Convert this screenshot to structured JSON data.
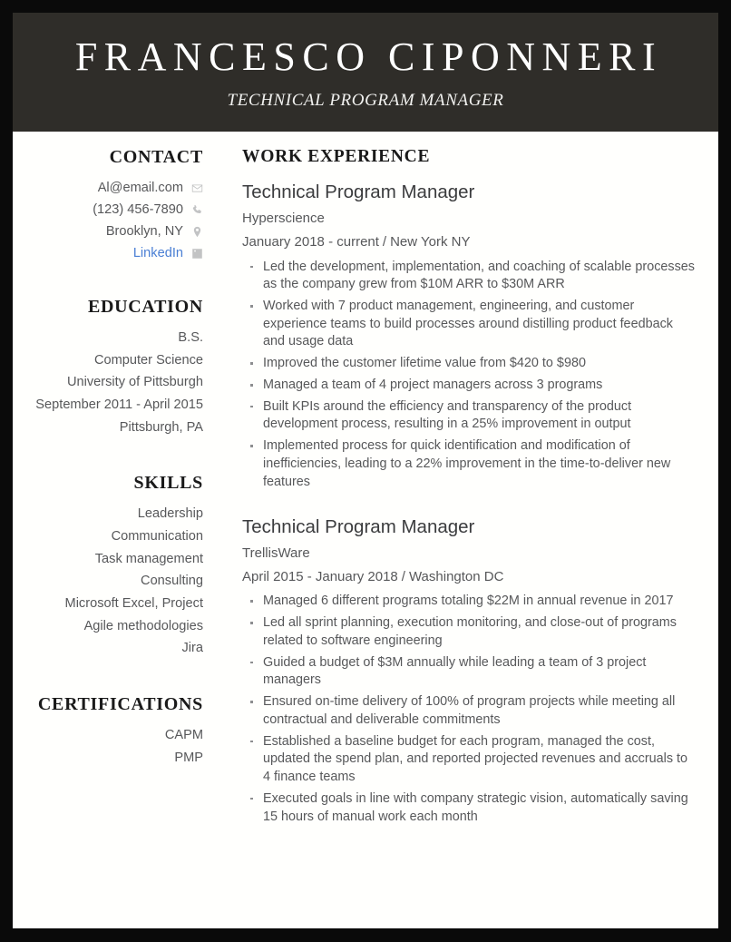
{
  "header": {
    "name": "FRANCESCO CIPONNERI",
    "title": "TECHNICAL PROGRAM MANAGER",
    "band_color": "#2f2d29",
    "name_color": "#ffffff"
  },
  "sidebar": {
    "contact": {
      "heading": "CONTACT",
      "items": [
        {
          "text": "Al@email.com",
          "icon": "envelope-icon",
          "is_link": false
        },
        {
          "text": "(123) 456-7890",
          "icon": "phone-icon",
          "is_link": false
        },
        {
          "text": "Brooklyn, NY",
          "icon": "location-pin-icon",
          "is_link": false
        },
        {
          "text": "LinkedIn",
          "icon": "linkedin-icon",
          "is_link": true
        }
      ],
      "link_color": "#4a7fd4",
      "icon_color": "#c2c3c4"
    },
    "education": {
      "heading": "EDUCATION",
      "lines": [
        "B.S.",
        "Computer Science",
        "University of Pittsburgh",
        "September 2011 - April 2015",
        "Pittsburgh, PA"
      ]
    },
    "skills": {
      "heading": "SKILLS",
      "lines": [
        "Leadership",
        "Communication",
        "Task management",
        "Consulting",
        "Microsoft Excel, Project",
        "Agile methodologies",
        "Jira"
      ]
    },
    "certifications": {
      "heading": "CERTIFICATIONS",
      "lines": [
        "CAPM",
        "PMP"
      ]
    }
  },
  "main": {
    "work_experience": {
      "heading": "WORK EXPERIENCE",
      "jobs": [
        {
          "title": "Technical Program Manager",
          "company": "Hyperscience",
          "dates": "January 2018 - current",
          "separator": "/",
          "location": "New York NY",
          "bullets": [
            "Led the development, implementation, and coaching of scalable processes as the company grew from $10M ARR to $30M ARR",
            "Worked with 7 product management, engineering, and customer experience teams to build processes around distilling product feedback and usage data",
            "Improved the customer lifetime value from $420 to $980",
            "Managed a team of 4 project managers across 3 programs",
            "Built KPIs around the efficiency and transparency of the product development process, resulting in a 25% improvement in output",
            "Implemented process for quick identification and modification of inefficiencies, leading to a 22% improvement in the time-to-deliver new features"
          ]
        },
        {
          "title": "Technical Program Manager",
          "company": "TrellisWare",
          "dates": "April 2015 - January 2018",
          "separator": "/",
          "location": "Washington DC",
          "bullets": [
            "Managed 6 different programs totaling $22M in annual revenue in 2017",
            "Led all sprint planning, execution monitoring, and close-out of programs related to software engineering",
            "Guided a budget of $3M annually while leading a team of 3 project managers",
            "Ensured on-time delivery of 100% of program projects while meeting all contractual and deliverable commitments",
            "Established a baseline budget for each program, managed the cost, updated the spend plan, and reported projected revenues and accruals to 4 finance teams",
            "Executed goals in line with company strategic vision, automatically saving 15 hours of manual work each month"
          ]
        }
      ]
    }
  }
}
